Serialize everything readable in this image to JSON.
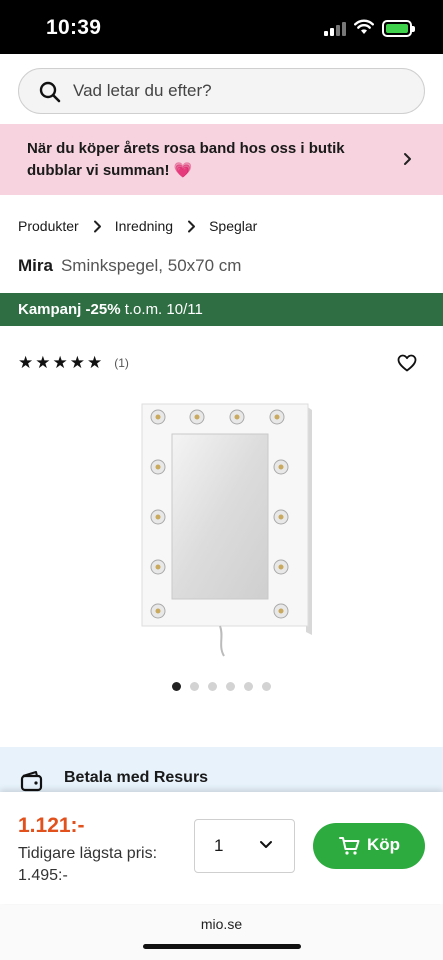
{
  "status_bar": {
    "time": "10:39",
    "icons": [
      "signal-icon",
      "wifi-icon",
      "battery-charging-icon"
    ]
  },
  "search": {
    "placeholder": "Vad letar du efter?",
    "value": "",
    "icon": "search-icon"
  },
  "promo": {
    "text": "När du köper årets rosa band hos oss i butik dubblar vi summan!",
    "emoji": "💗",
    "icon": "chevron-right-icon"
  },
  "breadcrumb": [
    "Produkter",
    "Inredning",
    "Speglar"
  ],
  "product": {
    "brand": "Mira",
    "name": "Sminkspegel, 50x70 cm",
    "campaign_bold": "Kampanj -25%",
    "campaign_rest": "t.o.m. 10/11",
    "rating": 5,
    "review_count": "(1)",
    "image_count": 6,
    "active_image": 1,
    "favorite_icon": "heart-icon"
  },
  "payment": {
    "label": "Betala med Resurs",
    "icon": "wallet-icon"
  },
  "buy": {
    "price": "1.121:-",
    "previous_label": "Tidigare lägsta pris:",
    "previous_price": "1.495:-",
    "quantity": "1",
    "button_label": "Köp",
    "button_icon": "cart-icon"
  },
  "browser": {
    "url": "mio.se"
  },
  "colors": {
    "status_bar": "#000000",
    "promo_bg": "#f6d3de",
    "campaign_bg": "#2e6e42",
    "price": "#e2501c",
    "buy_button": "#2dab3e",
    "payment_bg": "#e7f2fb"
  }
}
